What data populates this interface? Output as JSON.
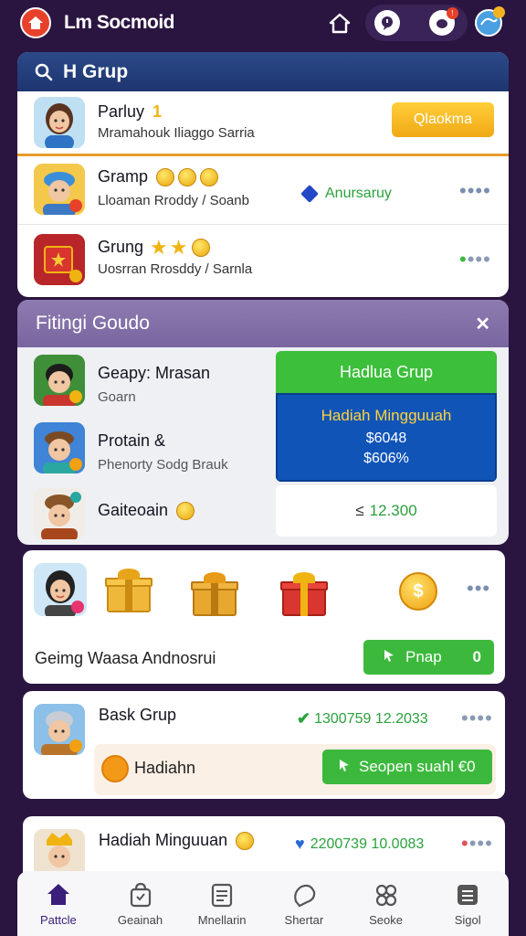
{
  "header": {
    "app_title": "Lm Socmoid"
  },
  "colors": {
    "background": "#2a1440",
    "brand_red": "#e8412b",
    "accent_green": "#3cb93c",
    "accent_yellow": "#f5b820",
    "panel_blue": "#1e3570",
    "reward_blue": "#1054b8"
  },
  "group_panel": {
    "title": "H Grup",
    "items": [
      {
        "title": "Parluy",
        "badge": "1",
        "subtitle": "Mramahouk Iliaggo Sarria",
        "button": "Qlaokma"
      },
      {
        "title": "Gramp",
        "subtitle": "Lloaman Rroddy / Soanb",
        "tag": "Anursaruy"
      },
      {
        "title": "Grung",
        "subtitle": "Uosrran Rrosddy / Sarnla"
      }
    ]
  },
  "filter_panel": {
    "title": "Fitingi Goudo",
    "items": [
      {
        "title": "Geapy: Mrasan",
        "subtitle": "Goarn"
      },
      {
        "title": "Protain &",
        "subtitle": "Phenorty Sodg Brauk"
      },
      {
        "title": "Gaiteoain"
      }
    ],
    "reward_card": {
      "header": "Hadlua Grup",
      "title": "Hadiah Mingguuah",
      "value1": "$6048",
      "value2": "$606%"
    },
    "amount": {
      "prefix": "≤",
      "value": "12.300"
    }
  },
  "gift_panel": {
    "coin_symbol": "$",
    "label": "Geimg Waasa Andnosrui",
    "button": "Pnap",
    "button_suffix": "0"
  },
  "bask_panel": {
    "title": "Bask Grup",
    "meta": "1300759 12.2033",
    "strip_label": "Hadiahn",
    "strip_button": "Seopen suahl €0"
  },
  "weekly_panel": {
    "title": "Hadiah Minguuan",
    "meta": "2200739 10.0083"
  },
  "bottom_nav": [
    {
      "label": "Pattcle",
      "icon": "home-icon",
      "active": true
    },
    {
      "label": "Geainah",
      "icon": "bag-icon",
      "active": false
    },
    {
      "label": "Mnellarin",
      "icon": "list-icon",
      "active": false
    },
    {
      "label": "Shertar",
      "icon": "chat-icon",
      "active": false
    },
    {
      "label": "Seoke",
      "icon": "game-icon",
      "active": false
    },
    {
      "label": "Sigol",
      "icon": "menu-icon",
      "active": false
    }
  ]
}
